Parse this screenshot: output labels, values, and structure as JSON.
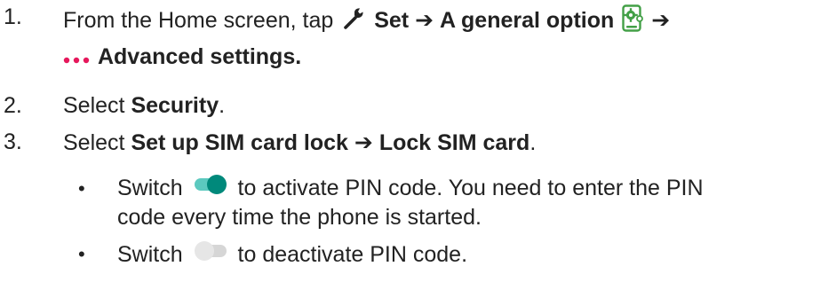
{
  "steps": [
    {
      "number": "1.",
      "line1_plain": "From the Home screen, tap",
      "set_label": "Set",
      "arrow1": "➔",
      "general_label": "A general option",
      "arrow2": "➔",
      "advanced_label": "Advanced settings."
    },
    {
      "number": "2.",
      "plain": "Select",
      "bold": "Security",
      "end": "."
    },
    {
      "number": "3.",
      "plain": "Select",
      "bold1": "Set up SIM card lock",
      "arrow": "➔",
      "bold2": "Lock SIM card",
      "end": "."
    }
  ],
  "bullets": [
    {
      "marker": "•",
      "word": "Switch",
      "line1": "to activate PIN code. You need to enter the PIN",
      "line2": "code every time the phone is started."
    },
    {
      "marker": "•",
      "word": "Switch",
      "line1": "to deactivate PIN code."
    }
  ],
  "colors": {
    "text": "#222222",
    "toggle_on_track": "#5cc9bf",
    "toggle_on_knob": "#00897b",
    "toggle_off_track": "#d0d0d0",
    "toggle_off_knob": "#ececec",
    "menu_dots": "#e6185c",
    "settings_icon": "#43a047"
  },
  "icons": [
    "wrench-icon",
    "settings-app-icon",
    "more-options-dots-icon",
    "toggle-on-icon",
    "toggle-off-icon"
  ]
}
